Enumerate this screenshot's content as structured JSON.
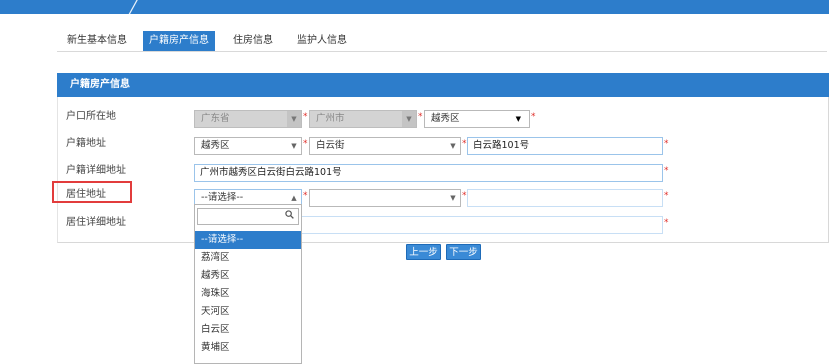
{
  "tabs": [
    {
      "label": "新生基本信息"
    },
    {
      "label": "户籍房产信息"
    },
    {
      "label": "住房信息"
    },
    {
      "label": "监护人信息"
    }
  ],
  "panel": {
    "title": "户籍房产信息"
  },
  "form": {
    "hukou_location": {
      "label": "户口所在地",
      "province": "广东省",
      "city": "广州市",
      "district": "越秀区"
    },
    "hukou_address": {
      "label": "户籍地址",
      "district": "越秀区",
      "street": "白云街",
      "road": "白云路101号"
    },
    "hukou_detail": {
      "label": "户籍详细地址",
      "value": "广州市越秀区白云街白云路101号"
    },
    "residence_address": {
      "label": "居住地址",
      "district_placeholder": "--请选择--"
    },
    "residence_detail": {
      "label": "居住详细地址"
    }
  },
  "dropdown": {
    "options": [
      "--请选择--",
      "荔湾区",
      "越秀区",
      "海珠区",
      "天河区",
      "白云区",
      "黄埔区"
    ],
    "selected_index": 0
  },
  "buttons": {
    "prev": "上一步",
    "next": "下一步"
  },
  "colors": {
    "primary": "#2d7dcb",
    "required": "#e0302b",
    "highlight": "#e23c3c"
  },
  "icons": {
    "search": "magnifier"
  }
}
